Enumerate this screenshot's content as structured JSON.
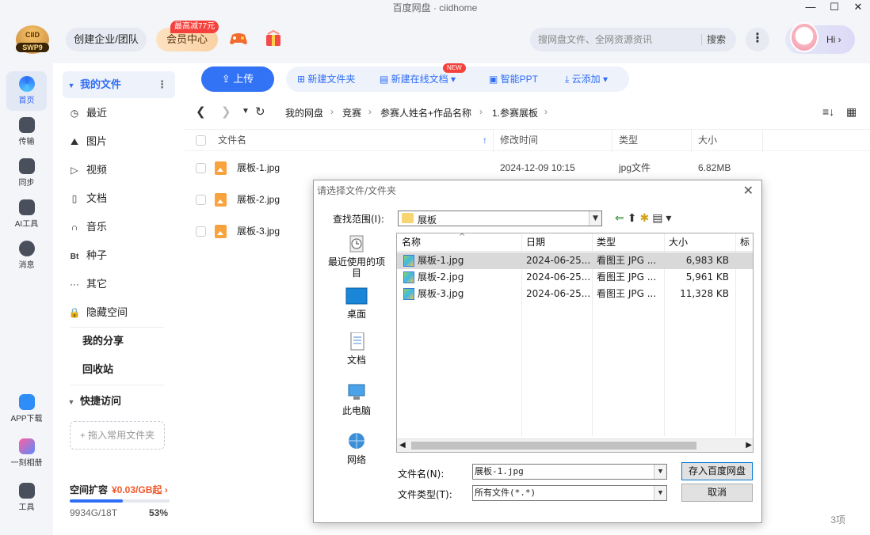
{
  "window": {
    "title": "百度网盘 · ciidhome",
    "controls": [
      "—",
      "☐",
      "✕"
    ]
  },
  "topbar": {
    "logo_text": "CIID",
    "logo_sub": "SWP9",
    "team_btn": "创建企业/团队",
    "vip_btn": "会员中心",
    "vip_badge": "最高减77元",
    "search_placeholder": "搜网盘文件、全网资源资讯",
    "search_btn": "搜索",
    "more": "⋮",
    "hi": "Hi ›"
  },
  "leftnav": [
    {
      "label": "首页",
      "icon": "home-icon"
    },
    {
      "label": "传输",
      "icon": "transfer-icon"
    },
    {
      "label": "同步",
      "icon": "sync-icon"
    },
    {
      "label": "AI工具",
      "icon": "ai-icon"
    },
    {
      "label": "消息",
      "icon": "message-icon"
    },
    {
      "label": "APP下载",
      "icon": "phone-icon"
    },
    {
      "label": "一刻相册",
      "icon": "album-icon"
    },
    {
      "label": "工具",
      "icon": "tools-icon"
    }
  ],
  "sidebar": {
    "my_files": "我的文件",
    "items": [
      {
        "label": "最近",
        "glyph": "◷"
      },
      {
        "label": "图片",
        "glyph": "⛰"
      },
      {
        "label": "视频",
        "glyph": "▷"
      },
      {
        "label": "文档",
        "glyph": "▯"
      },
      {
        "label": "音乐",
        "glyph": "∩"
      },
      {
        "label": "种子",
        "glyph": "Bt"
      },
      {
        "label": "其它",
        "glyph": "···"
      },
      {
        "label": "隐藏空间",
        "glyph": "🔒"
      }
    ],
    "my_share": "我的分享",
    "recycle": "回收站",
    "quick_access": "快捷访问",
    "drop_hint": "+ 拖入常用文件夹",
    "space_title": "空间扩容",
    "space_price": "¥0.03/GB起 ›",
    "space_used": "9934G/18T",
    "space_pct": "53%",
    "space_fraction": 0.53
  },
  "toolbar": {
    "upload": "上传",
    "new_folder": "新建文件夹",
    "new_doc": "新建在线文档",
    "new_badge": "NEW",
    "smart_ppt": "智能PPT",
    "cloud_add": "云添加"
  },
  "path": [
    "我的网盘",
    "竞赛",
    "参赛人姓名+作品名称",
    "1.参赛展板"
  ],
  "table": {
    "headers": {
      "name": "文件名",
      "mtime": "修改时间",
      "type": "类型",
      "size": "大小"
    },
    "rows": [
      {
        "name": "展板-1.jpg",
        "mtime": "2024-12-09 10:15",
        "type": "jpg文件",
        "size": "6.82MB"
      },
      {
        "name": "展板-2.jpg",
        "mtime": "",
        "type": "",
        "size": ""
      },
      {
        "name": "展板-3.jpg",
        "mtime": "",
        "type": "",
        "size": ""
      }
    ],
    "count": "3项"
  },
  "dialog": {
    "title": "请选择文件/文件夹",
    "lookin_label": "查找范围(I):",
    "lookin_value": "展板",
    "places": [
      "最近使用的项目",
      "桌面",
      "文档",
      "此电脑",
      "网络"
    ],
    "headers": [
      "名称",
      "日期",
      "类型",
      "大小",
      "标"
    ],
    "files": [
      {
        "name": "展板-1.jpg",
        "date": "2024-06-25...",
        "type": "看图王 JPG ...",
        "size": "6,983 KB"
      },
      {
        "name": "展板-2.jpg",
        "date": "2024-06-25...",
        "type": "看图王 JPG ...",
        "size": "5,961 KB"
      },
      {
        "name": "展板-3.jpg",
        "date": "2024-06-25...",
        "type": "看图王 JPG ...",
        "size": "11,328 KB"
      }
    ],
    "filename_label": "文件名(N):",
    "filename_value": "展板-1.jpg",
    "filetype_label": "文件类型(T):",
    "filetype_value": "所有文件(*.*)",
    "save_btn": "存入百度网盘",
    "cancel_btn": "取消"
  }
}
